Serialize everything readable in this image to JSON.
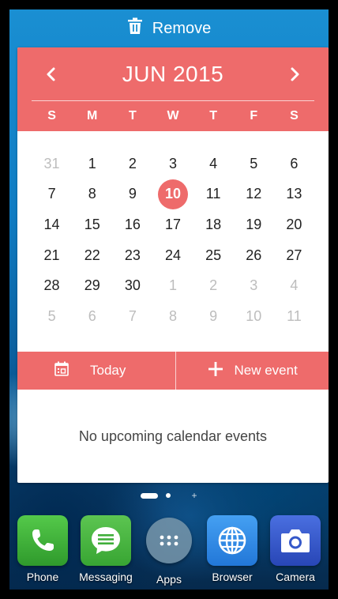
{
  "remove_bar": {
    "label": "Remove",
    "icon": "trash-icon"
  },
  "calendar": {
    "month_label": "JUN 2015",
    "prev_icon": "chevron-left-icon",
    "next_icon": "chevron-right-icon",
    "weekdays": [
      "S",
      "M",
      "T",
      "W",
      "T",
      "F",
      "S"
    ],
    "weeks": [
      [
        {
          "d": "31",
          "muted": true
        },
        {
          "d": "1"
        },
        {
          "d": "2"
        },
        {
          "d": "3"
        },
        {
          "d": "4"
        },
        {
          "d": "5"
        },
        {
          "d": "6"
        }
      ],
      [
        {
          "d": "7"
        },
        {
          "d": "8"
        },
        {
          "d": "9"
        },
        {
          "d": "10",
          "today": true
        },
        {
          "d": "11"
        },
        {
          "d": "12"
        },
        {
          "d": "13"
        }
      ],
      [
        {
          "d": "14"
        },
        {
          "d": "15"
        },
        {
          "d": "16"
        },
        {
          "d": "17"
        },
        {
          "d": "18"
        },
        {
          "d": "19"
        },
        {
          "d": "20"
        }
      ],
      [
        {
          "d": "21"
        },
        {
          "d": "22"
        },
        {
          "d": "23"
        },
        {
          "d": "24"
        },
        {
          "d": "25"
        },
        {
          "d": "26"
        },
        {
          "d": "27"
        }
      ],
      [
        {
          "d": "28"
        },
        {
          "d": "29"
        },
        {
          "d": "30"
        },
        {
          "d": "1",
          "muted": true
        },
        {
          "d": "2",
          "muted": true
        },
        {
          "d": "3",
          "muted": true
        },
        {
          "d": "4",
          "muted": true
        }
      ],
      [
        {
          "d": "5",
          "muted": true
        },
        {
          "d": "6",
          "muted": true
        },
        {
          "d": "7",
          "muted": true
        },
        {
          "d": "8",
          "muted": true
        },
        {
          "d": "9",
          "muted": true
        },
        {
          "d": "10",
          "muted": true
        },
        {
          "d": "11",
          "muted": true
        }
      ]
    ],
    "today_button": "Today",
    "new_event_button": "New event",
    "empty_message": "No upcoming calendar events",
    "accent_color": "#ee6b6b"
  },
  "dock": [
    {
      "label": "Phone",
      "icon": "phone-icon",
      "color": "#3fae3a"
    },
    {
      "label": "Messaging",
      "icon": "message-icon",
      "color": "#46b33f"
    },
    {
      "label": "Apps",
      "icon": "apps-grid-icon",
      "color": "#5f7f96"
    },
    {
      "label": "Browser",
      "icon": "globe-icon",
      "color": "#2f86e6"
    },
    {
      "label": "Camera",
      "icon": "camera-icon",
      "color": "#3558c9"
    }
  ]
}
